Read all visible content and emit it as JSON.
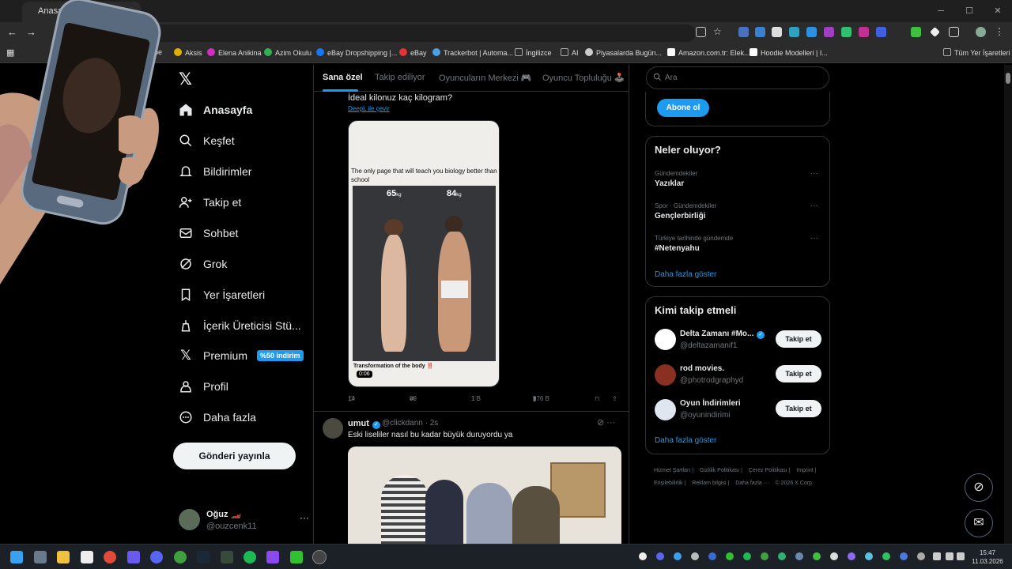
{
  "browser": {
    "tab_title": "Anasayfa",
    "window_controls": {
      "minimize": "─",
      "maximize": "☐",
      "close": "✕"
    },
    "bookmarks": [
      {
        "label": "ube",
        "color": "#ff0000"
      },
      {
        "label": "Aksis",
        "color": "#e0b000"
      },
      {
        "label": "Elena Anikina",
        "color": "#d030c0"
      },
      {
        "label": "Azim Okulu",
        "color": "#30b050"
      },
      {
        "label": "eBay Dropshipping |...",
        "color": "#1877f2"
      },
      {
        "label": "eBay",
        "color": "#e53238"
      },
      {
        "label": "Trackerbot | Automa...",
        "color": "#4aa0e0"
      },
      {
        "label": "İngilizce",
        "color": "#888888"
      },
      {
        "label": "AI",
        "color": "#888888"
      },
      {
        "label": "Piyasalarda Bugün...",
        "color": "#cccccc"
      },
      {
        "label": "Amazon.com.tr: Elek...",
        "color": "#ffffff"
      },
      {
        "label": "Hoodie Modelleri | I...",
        "color": "#ffffff"
      }
    ],
    "all_bookmarks": "Tüm Yer İşaretleri"
  },
  "sidebar": {
    "nav": [
      {
        "label": "Anasayfa",
        "icon": "home-icon",
        "active": true
      },
      {
        "label": "Keşfet",
        "icon": "search-icon"
      },
      {
        "label": "Bildirimler",
        "icon": "bell-icon"
      },
      {
        "label": "Takip et",
        "icon": "add-user-icon"
      },
      {
        "label": "Sohbet",
        "icon": "mail-icon"
      },
      {
        "label": "Grok",
        "icon": "grok-icon"
      },
      {
        "label": "Yer İşaretleri",
        "icon": "bookmark-icon"
      },
      {
        "label": "İçerik Üreticisi Stü...",
        "icon": "studio-icon"
      },
      {
        "label": "Premium",
        "icon": "x-logo-icon",
        "badge": "%50 indirim"
      },
      {
        "label": "Profil",
        "icon": "person-icon"
      },
      {
        "label": "Daha fazla",
        "icon": "more-circle-icon"
      }
    ],
    "post_button": "Gönderi yayınla",
    "account": {
      "name": "Oğuz 🏎️",
      "handle": "@ouzcenk11"
    }
  },
  "timeline": {
    "tabs": [
      "Sana özel",
      "Takip ediliyor",
      "Oyuncuların Merkezi 🎮",
      "Oyuncu Topluluğu 🕹️"
    ],
    "tweet1": {
      "text": "İdeal kilonuz kaç kilogram?",
      "translate": "DeepL ile çevir",
      "media_text": "The only page that will teach you biology better than school",
      "weight_left": "65",
      "weight_right": "84",
      "unit": "kg",
      "caption": "Transformation of the body ‼️",
      "duration": "0:06",
      "replies": "14",
      "reposts": "89",
      "likes": "1 B",
      "views": "976 B"
    },
    "tweet2": {
      "name": "umut",
      "handle": "@clickdann · 2s",
      "text": "Eski liseliler nasıl bu kadar büyük duruyordu ya"
    }
  },
  "right": {
    "search_placeholder": "Ara",
    "subscribe": "Abone ol",
    "trends_title": "Neler oluyor?",
    "trends": [
      {
        "meta": "Gündemdekiler",
        "name": "Yazıklar"
      },
      {
        "meta": "Spor · Gündemdekiler",
        "name": "Gençlerbirliği"
      },
      {
        "meta": "Türkiye tarihinde gündemde",
        "name": "#Netenyahu"
      }
    ],
    "show_more": "Daha fazla göster",
    "who_title": "Kimi takip etmeli",
    "who": [
      {
        "name": "Delta Zamanı #Mo...",
        "handle": "@deltazamanif1",
        "verified": true,
        "follow": "Takip et"
      },
      {
        "name": "rod movies.",
        "handle": "@photrodgraphyd",
        "verified": false,
        "follow": "Takip et"
      },
      {
        "name": "Oyun İndirimleri",
        "handle": "@oyunindirimi",
        "verified": true,
        "follow": "Takip et"
      }
    ],
    "who_show_more": "Daha fazla göster",
    "footer": [
      "Hizmet Şartları |",
      "Gizlilik Politikası |",
      "Çerez Politikası |",
      "Imprint |",
      "Erişilebilirlik |",
      "Reklam bilgisi |",
      "Daha fazla ···",
      "© 2026 X Corp."
    ]
  },
  "taskbar": {
    "time": "15:47",
    "date": "11.03.2026"
  }
}
